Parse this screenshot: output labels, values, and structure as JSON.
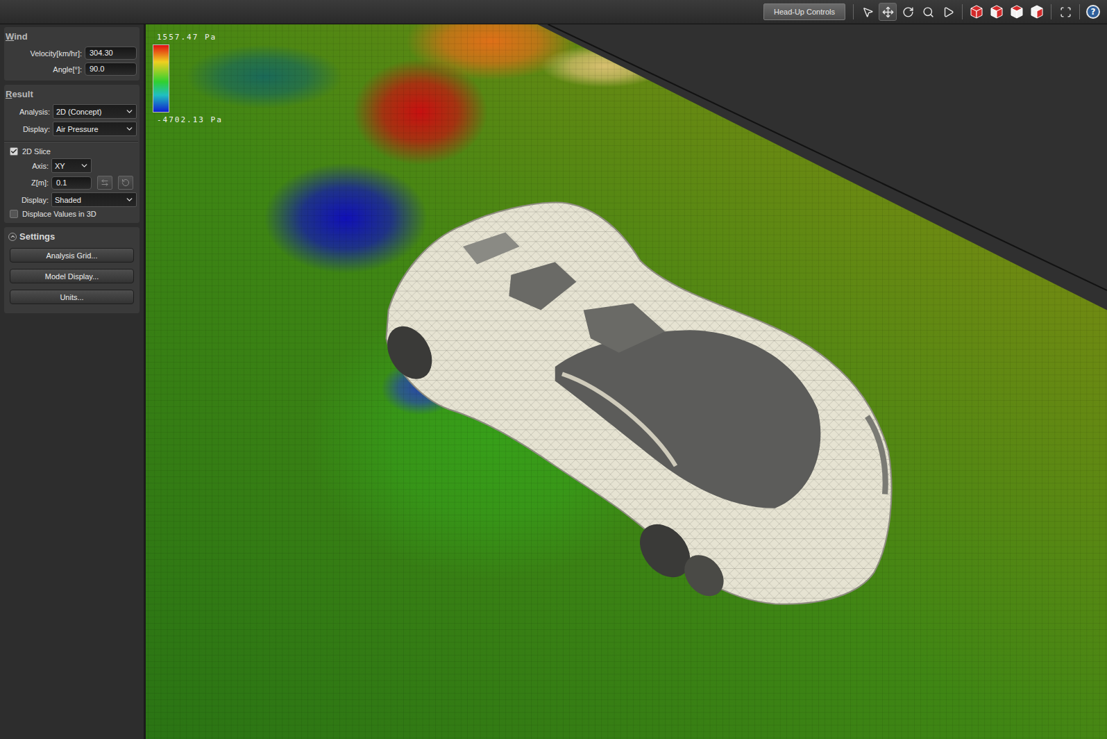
{
  "toolbar": {
    "hud_button": "Head-Up Controls",
    "tools": [
      {
        "kind": "select",
        "selected": false
      },
      {
        "kind": "pan",
        "selected": true
      },
      {
        "kind": "orbit",
        "selected": false
      },
      {
        "kind": "zoom",
        "selected": false
      },
      {
        "kind": "play",
        "selected": false
      },
      {
        "kind": "cube-front",
        "selected": false
      },
      {
        "kind": "cube-top",
        "selected": false
      },
      {
        "kind": "cube-side",
        "selected": false
      },
      {
        "kind": "cube-iso",
        "selected": false
      },
      {
        "kind": "fit",
        "selected": false
      }
    ],
    "help": "?"
  },
  "wind": {
    "title": "Wind",
    "fields": [
      {
        "label": "Velocity[km/hr]:",
        "value": "304.30"
      },
      {
        "label": "Angle[°]:",
        "value": "90.0"
      }
    ]
  },
  "result": {
    "title": "Result",
    "analysis": {
      "label": "Analysis:",
      "value": "2D (Concept)"
    },
    "display": {
      "label": "Display:",
      "value": "Air Pressure"
    },
    "slice": {
      "label": "2D Slice",
      "checked": true
    },
    "axis": {
      "label": "Axis:",
      "value": "XY"
    },
    "z": {
      "label": "Z[m]:",
      "value": "0.1"
    },
    "slice_display": {
      "label": "Display:",
      "value": "Shaded"
    },
    "displace": {
      "label": "Displace Values in 3D",
      "checked": false
    }
  },
  "settings": {
    "title": "Settings",
    "expanded": true,
    "buttons": [
      "Analysis Grid...",
      "Model Display...",
      "Units..."
    ]
  },
  "legend": {
    "max": "1557.47 Pa",
    "min": "-4702.13 Pa"
  }
}
